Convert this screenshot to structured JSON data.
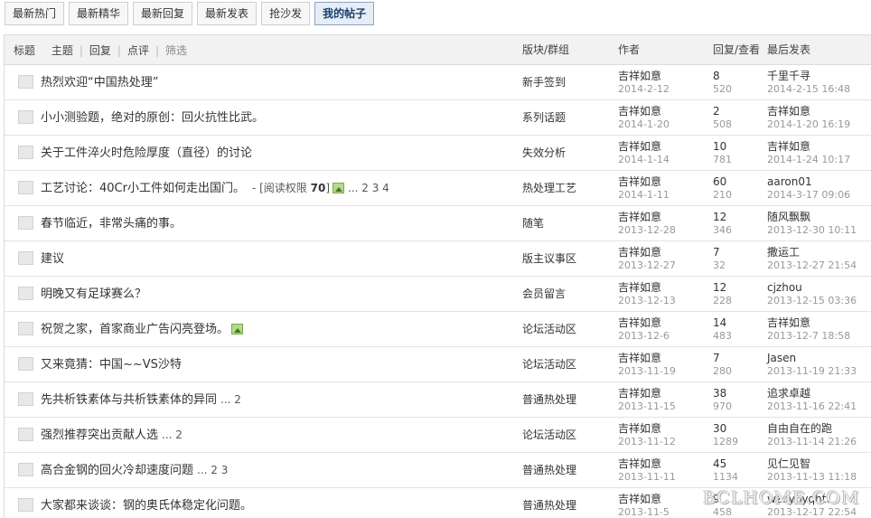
{
  "tabs": [
    {
      "label": "最新热门",
      "active": false
    },
    {
      "label": "最新精华",
      "active": false
    },
    {
      "label": "最新回复",
      "active": false
    },
    {
      "label": "最新发表",
      "active": false
    },
    {
      "label": "抢沙发",
      "active": false
    },
    {
      "label": "我的帖子",
      "active": true
    }
  ],
  "header": {
    "title": "标题",
    "filter_subject": "主题",
    "filter_reply": "回复",
    "filter_review": "点评",
    "filter_screen": "筛选",
    "forum": "版块/群组",
    "author": "作者",
    "counts": "回复/查看",
    "last": "最后发表"
  },
  "rows": [
    {
      "title": "热烈欢迎“中国热处理”",
      "pages": "",
      "perm": "",
      "image": false,
      "forum": "新手签到",
      "author": "吉祥如意",
      "date": "2014-2-12",
      "replies": "8",
      "views": "520",
      "last_user": "千里千寻",
      "last_time": "2014-2-15 16:48"
    },
    {
      "title": "小小测验题，绝对的原创：回火抗性比武。",
      "pages": "",
      "perm": "",
      "image": false,
      "forum": "系列话题",
      "author": "吉祥如意",
      "date": "2014-1-20",
      "replies": "2",
      "views": "508",
      "last_user": "吉祥如意",
      "last_time": "2014-1-20 16:19"
    },
    {
      "title": "关于工件淬火时危险厚度（直径）的讨论",
      "pages": "",
      "perm": "",
      "image": false,
      "forum": "失效分析",
      "author": "吉祥如意",
      "date": "2014-1-14",
      "replies": "10",
      "views": "781",
      "last_user": "吉祥如意",
      "last_time": "2014-1-24 10:17"
    },
    {
      "title": "工艺讨论：40Cr小工件如何走出国门。",
      "pages": "... 2 3 4",
      "perm_prefix": "- [阅读权限 ",
      "perm_value": "70",
      "perm_suffix": "]",
      "image": true,
      "forum": "热处理工艺",
      "author": "吉祥如意",
      "date": "2014-1-11",
      "replies": "60",
      "views": "210",
      "last_user": "aaron01",
      "last_time": "2014-3-17 09:06"
    },
    {
      "title": "春节临近，非常头痛的事。",
      "pages": "",
      "perm": "",
      "image": false,
      "forum": "随笔",
      "author": "吉祥如意",
      "date": "2013-12-28",
      "replies": "12",
      "views": "346",
      "last_user": "随风飘飘",
      "last_time": "2013-12-30 10:11"
    },
    {
      "title": "建议",
      "pages": "",
      "perm": "",
      "image": false,
      "forum": "版主议事区",
      "author": "吉祥如意",
      "date": "2013-12-27",
      "replies": "7",
      "views": "32",
      "last_user": "撒运工",
      "last_time": "2013-12-27 21:54"
    },
    {
      "title": "明晚又有足球赛么？",
      "pages": "",
      "perm": "",
      "image": false,
      "forum": "会员留言",
      "author": "吉祥如意",
      "date": "2013-12-13",
      "replies": "12",
      "views": "228",
      "last_user": "cjzhou",
      "last_time": "2013-12-15 03:36"
    },
    {
      "title": "祝贺之家，首家商业广告闪亮登场。",
      "pages": "",
      "perm": "",
      "image": true,
      "forum": "论坛活动区",
      "author": "吉祥如意",
      "date": "2013-12-6",
      "replies": "14",
      "views": "483",
      "last_user": "吉祥如意",
      "last_time": "2013-12-7 18:58"
    },
    {
      "title": "又来竟猜：中国~~VS沙特",
      "pages": "",
      "perm": "",
      "image": false,
      "forum": "论坛活动区",
      "author": "吉祥如意",
      "date": "2013-11-19",
      "replies": "7",
      "views": "280",
      "last_user": "Jasen",
      "last_time": "2013-11-19 21:33"
    },
    {
      "title": "先共析铁素体与共析铁素体的异同",
      "pages": "... 2",
      "perm": "",
      "image": false,
      "forum": "普通热处理",
      "author": "吉祥如意",
      "date": "2013-11-15",
      "replies": "38",
      "views": "970",
      "last_user": "追求卓越",
      "last_time": "2013-11-16 22:41"
    },
    {
      "title": "强烈推荐突出贡献人选",
      "pages": "... 2",
      "perm": "",
      "image": false,
      "forum": "论坛活动区",
      "author": "吉祥如意",
      "date": "2013-11-12",
      "replies": "30",
      "views": "1289",
      "last_user": "自由自在的跑",
      "last_time": "2013-11-14 21:26"
    },
    {
      "title": "高合金钢的回火冷却速度问题",
      "pages": "... 2 3",
      "perm": "",
      "image": false,
      "forum": "普通热处理",
      "author": "吉祥如意",
      "date": "2013-11-11",
      "replies": "45",
      "views": "1134",
      "last_user": "见仁见智",
      "last_time": "2013-11-13 11:18"
    },
    {
      "title": "大家都来谈谈：钢的奥氏体稳定化问题。",
      "pages": "",
      "perm": "",
      "image": false,
      "forum": "普通热处理",
      "author": "吉祥如意",
      "date": "2013-11-5",
      "replies": "9",
      "views": "458",
      "last_user": "wzdybyqhtt",
      "last_time": "2013-12-17 22:54"
    }
  ],
  "watermark": "BCLHOME.COM"
}
